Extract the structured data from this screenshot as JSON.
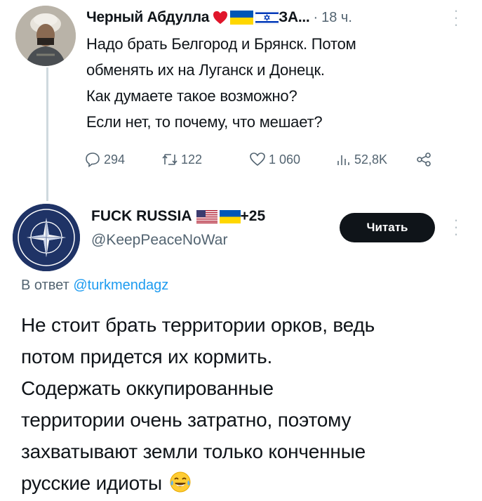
{
  "tweet1": {
    "author_name": "Черный Абдулла",
    "author_suffix": "ЗА...",
    "separator": "·",
    "time": "18 ч.",
    "more_icon": "more-vertical-icon",
    "lines": [
      "Надо брать Белгород и Брянск. Потом",
      "обменять их на Луганск и Донецк.",
      "Как думаете такое возможно?",
      "Если нет, то почему, что мешает?"
    ],
    "actions": {
      "replies": "294",
      "retweets": "122",
      "likes": "1 060",
      "views": "52,8K"
    }
  },
  "tweet2": {
    "author_name": "FUCK RUSSIA",
    "author_suffix": "+25",
    "handle": "@KeepPeaceNoWar",
    "follow_label": "Читать",
    "reply_prefix": "В ответ",
    "reply_handle": "@turkmendagz",
    "lines": [
      "Не стоит брать территории орков, ведь",
      "потом придется их кормить.",
      "Содержать оккупированные",
      "территории очень затратно, поэтому",
      "захватывают земли только конченные",
      "русские идиоты"
    ],
    "avatar_text": [
      "NORTH",
      "ATLANTIC",
      "TREATY",
      "ORGANIZATION"
    ]
  },
  "colors": {
    "text": "#0f1419",
    "secondary": "#536471",
    "link": "#1d9bf0",
    "button": "#0f1419"
  }
}
